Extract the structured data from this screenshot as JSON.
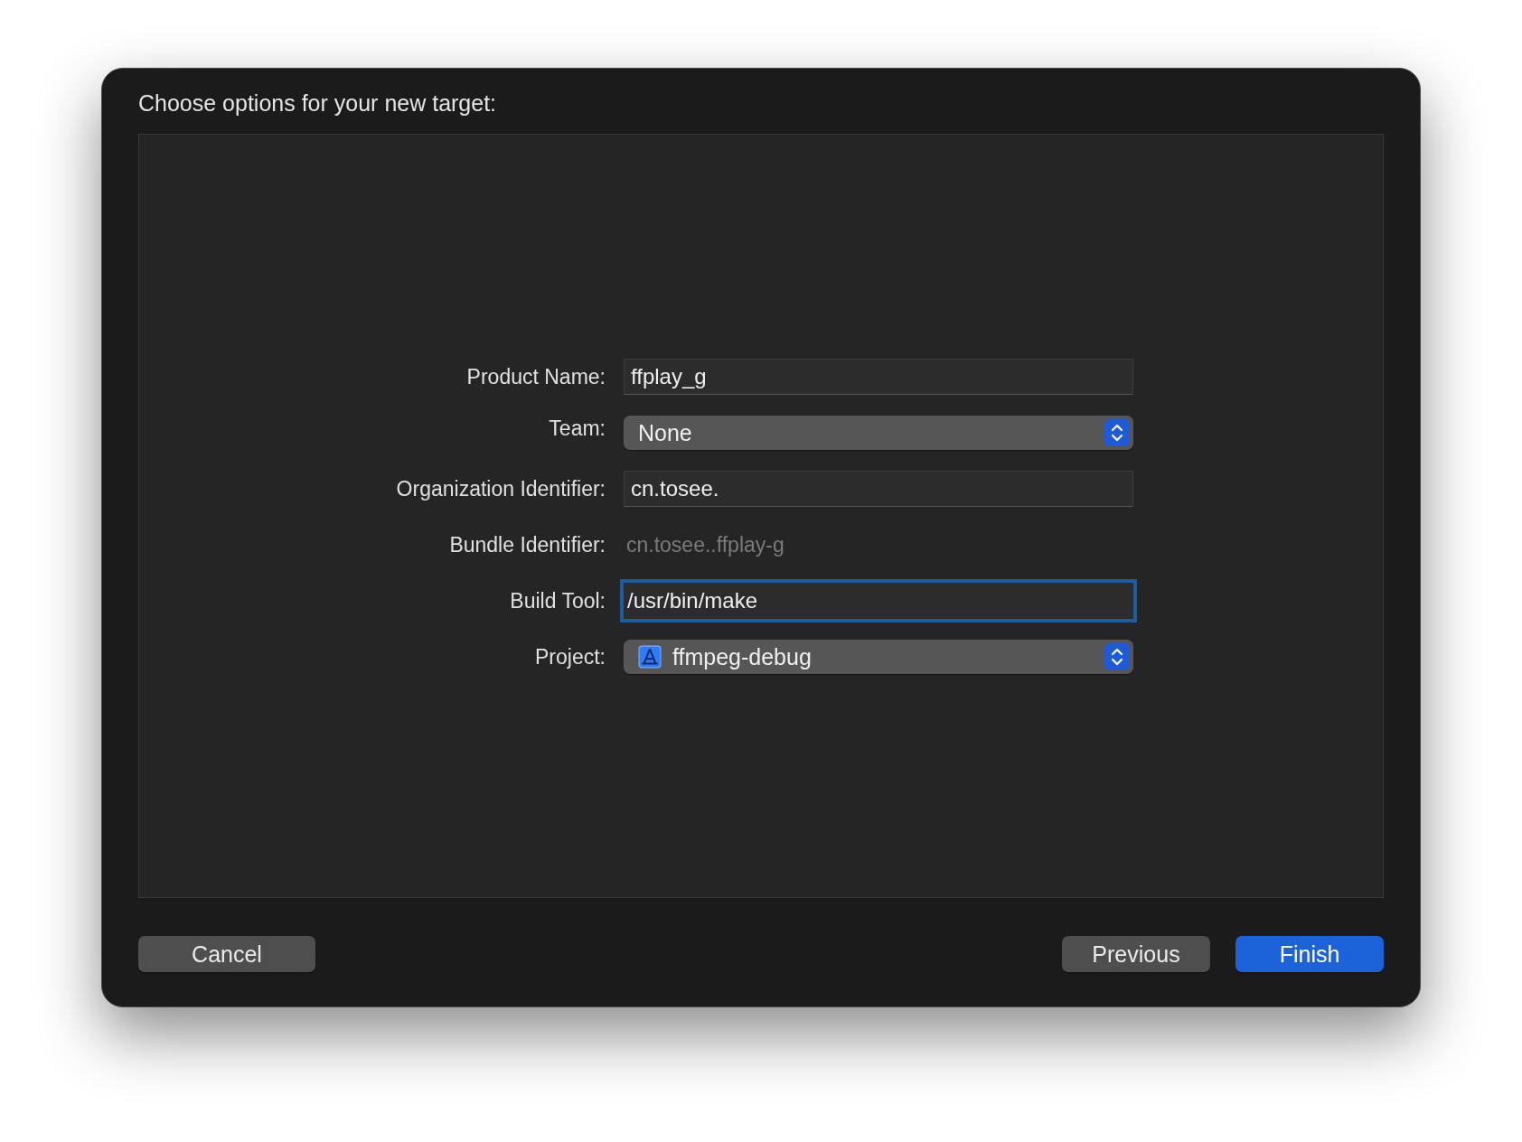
{
  "dialog": {
    "title": "Choose options for your new target:"
  },
  "fields": [
    {
      "label": "Product Name:",
      "kind": "text",
      "value": "ffplay_g",
      "focused": false
    },
    {
      "label": "Team:",
      "kind": "popup",
      "value": "None",
      "has_icon": false
    },
    {
      "label": "Organization Identifier:",
      "kind": "text",
      "value": "cn.tosee.",
      "focused": false
    },
    {
      "label": "Bundle Identifier:",
      "kind": "static",
      "value": "cn.tosee..ffplay-g"
    },
    {
      "label": "Build Tool:",
      "kind": "text",
      "value": "/usr/bin/make",
      "focused": true
    },
    {
      "label": "Project:",
      "kind": "popup",
      "value": "ffmpeg-debug",
      "has_icon": true
    }
  ],
  "footer": {
    "left_buttons": [
      {
        "label": "Cancel",
        "default": false
      }
    ],
    "right_buttons": [
      {
        "label": "Previous",
        "default": false
      },
      {
        "label": "Finish",
        "default": true
      }
    ]
  }
}
